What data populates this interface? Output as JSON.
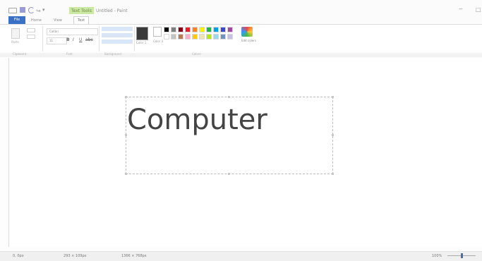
{
  "window": {
    "title": "Untitled - Paint",
    "contextual_tab_title": "Text Tools",
    "minimize_glyph": "‒",
    "maximize_glyph": "□",
    "quick_access": {
      "redo_glyph": "↪",
      "dropdown_glyph": "▾"
    }
  },
  "tabs": [
    "File",
    "Home",
    "View",
    "Text"
  ],
  "ribbon": {
    "clipboard": {
      "group_label": "Clipboard",
      "paste_label": "Paste"
    },
    "font": {
      "group_label": "Font",
      "font_name": "Calibri",
      "font_size": "11",
      "bold": "B",
      "italic": "I",
      "underline": "U",
      "strike": "abc"
    },
    "background": {
      "group_label": "Background"
    },
    "colors": {
      "group_label": "Colors",
      "color1_label": "Color 1",
      "color2_label": "Color 2",
      "edit_colors_label": "Edit colors",
      "palette_row1": [
        "#000000",
        "#7f7f7f",
        "#880015",
        "#ed1c24",
        "#ff7f27",
        "#fff200",
        "#22b14c",
        "#00a2e8",
        "#3f48cc",
        "#a349a4"
      ],
      "palette_row2": [
        "#ffffff",
        "#c3c3c3",
        "#b97a57",
        "#ffaec9",
        "#ffc90e",
        "#efe4b0",
        "#b5e61d",
        "#99d9ea",
        "#7092be",
        "#c8bfe7"
      ]
    },
    "accent_color": "#3a70c6"
  },
  "canvas": {
    "text_content": "Computer"
  },
  "status_bar": {
    "cursor_position": "0, 0px",
    "selection_size": "293 × 109px",
    "image_size": "1366 × 768px",
    "zoom_level": "100%"
  }
}
